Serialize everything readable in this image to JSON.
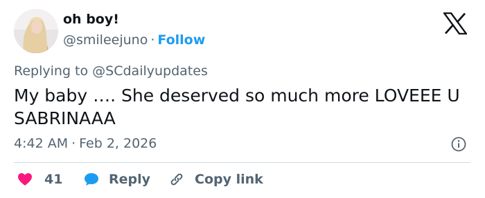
{
  "author": {
    "display_name": "oh boy!",
    "handle": "@smileejuno",
    "separator": "·",
    "follow_label": "Follow"
  },
  "reply_context": {
    "prefix": "Replying to",
    "mention": "@SCdailyupdates"
  },
  "tweet": {
    "text": "My baby …. She deserved so much more LOVEEE U SABRINAAA",
    "time": "4:42 AM",
    "separator": "·",
    "date": "Feb 2, 2026"
  },
  "actions": {
    "like_count": "41",
    "reply_label": "Reply",
    "copy_link_label": "Copy link"
  },
  "colors": {
    "accent": "#1d9bf0",
    "like": "#f91880",
    "secondary_text": "#536471",
    "primary_text": "#0f1419",
    "divider": "#cfd9de"
  },
  "icons": {
    "platform_logo": "x-logo-icon",
    "info": "info-icon",
    "like": "heart-icon",
    "reply": "speech-bubble-icon",
    "copy_link": "link-icon"
  }
}
